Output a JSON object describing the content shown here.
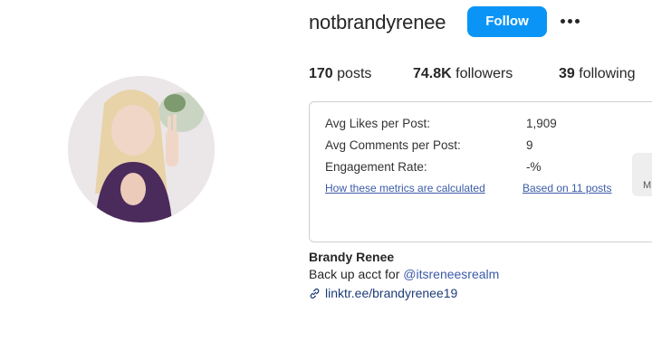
{
  "profile": {
    "username": "notbrandyrenee",
    "follow_label": "Follow",
    "more_icon": "more-horizontal-icon"
  },
  "stats": {
    "posts_count": "170",
    "posts_label": "posts",
    "followers_count": "74.8K",
    "followers_label": "followers",
    "following_count": "39",
    "following_label": "following"
  },
  "metrics": {
    "rows": [
      {
        "label": "Avg Likes per Post:",
        "value": "1,909"
      },
      {
        "label": "Avg Comments per Post:",
        "value": "9"
      },
      {
        "label": "Engagement Rate:",
        "value": "-%"
      }
    ],
    "calc_link": "How these metrics are calculated",
    "based_on": "Based on 11 posts",
    "side_tab_text": "M"
  },
  "bio": {
    "name": "Brandy Renee",
    "text_prefix": "Back up acct for ",
    "mention": "@itsreneesrealm",
    "link": "linktr.ee/brandyrenee19",
    "link_icon": "link-icon"
  }
}
